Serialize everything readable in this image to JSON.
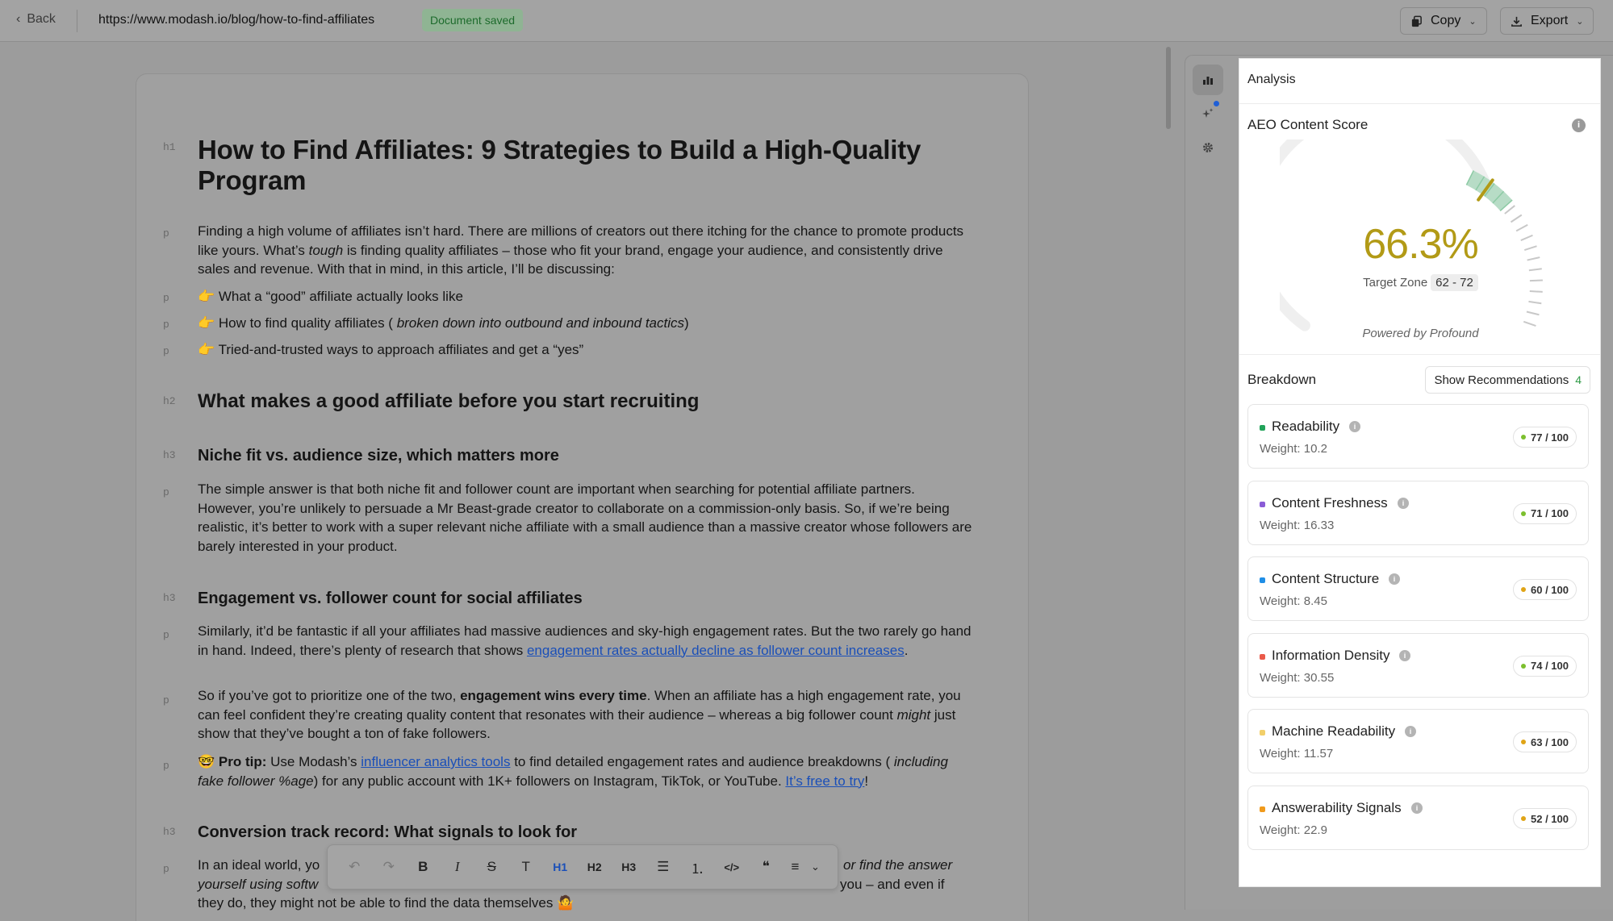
{
  "topbar": {
    "back_label": "Back",
    "url": "https://www.modash.io/blog/how-to-find-affiliates",
    "status": "Document saved",
    "copy_label": "Copy",
    "export_label": "Export"
  },
  "document": {
    "h1": "How to Find Affiliates: 9 Strategies to Build a High-Quality Program",
    "intro": {
      "a": "Finding a high volume of affiliates isn’t hard. There are millions of creators out there itching for the chance to promote products like yours. What’s ",
      "b": "tough",
      "c": " is finding quality affiliates – those who fit your brand, engage your audience, and consistently drive sales and revenue. With that in mind, in this article, I’ll be discussing:"
    },
    "bullets": {
      "one": "👉 What a “good” affiliate actually looks like",
      "two_a": "👉 How to find quality affiliates ( ",
      "two_b": "broken down into outbound and inbound tactics",
      "two_c": ")",
      "three": "👉 Tried-and-trusted ways to approach affiliates and get a “yes”"
    },
    "h2_recruiting": "What makes a good affiliate before you start recruiting",
    "h3_niche": "Niche fit vs. audience size, which matters more",
    "p_niche": "The simple answer is that both niche fit and follower count are important when searching for potential affiliate partners. However, you’re unlikely to persuade a Mr Beast-grade creator to collaborate on a commission-only basis. So, if we’re being realistic, it’s better to work with a super relevant niche affiliate with a small audience than a massive creator whose followers are barely interested in your product.",
    "h3_engagement": "Engagement vs. follower count for social affiliates",
    "p_eng1": {
      "a": "Similarly, it’d be fantastic if all your affiliates had massive audiences and sky-high engagement rates. But the two rarely go hand in hand. Indeed, there’s plenty of research that shows ",
      "link": "engagement rates actually decline as follower count increases",
      "c": "."
    },
    "p_eng2": {
      "a": "So if you’ve got to prioritize one of the two, ",
      "b": "engagement wins every time",
      "c": ". When an affiliate has a high engagement rate, you can feel confident they’re creating quality content that resonates with their audience – whereas a big follower count ",
      "d": "might",
      "e": " just show that they’ve bought a ton of fake followers."
    },
    "p_tip": {
      "emoji": "🤓 ",
      "label": "Pro tip:",
      "a": " Use Modash’s ",
      "link1": "influencer analytics tools",
      "b": " to find detailed engagement rates and audience breakdowns ( ",
      "c": "including fake follower %age",
      "d": ") for any public account with 1K+ followers on Instagram, TikTok, or YouTube. ",
      "link2": "It’s free to try",
      "e": "!"
    },
    "h3_conversion": "Conversion track record: What signals to look for",
    "p_conv": {
      "a": "In an ideal world, yo",
      "b": "or find the answer",
      "c": "yourself using softw",
      "d": " you – and even if",
      "e": "they do, they might not be able to find the data themselves 🤷"
    }
  },
  "tags": {
    "h1": "h1",
    "h2": "h2",
    "h3": "h3",
    "p": "p"
  },
  "toolbar": {
    "undo": "↶",
    "redo": "↷",
    "bold": "B",
    "italic": "I",
    "strike": "S",
    "text": "T",
    "h1": "H1",
    "h2": "H2",
    "h3": "H3",
    "bullets": "☰",
    "numbered": "⒈",
    "code": "</>",
    "quote": "❝",
    "align": "≡",
    "more": "⌄"
  },
  "panel": {
    "header": "Analysis",
    "score_title": "AEO Content Score",
    "score": 66.3,
    "score_text": "66.3%",
    "target_label": "Target Zone",
    "target_zone": "62 - 72",
    "powered_by": "Powered by Profound",
    "breakdown_title": "Breakdown",
    "recommendations_label": "Show Recommendations",
    "recommendations_count": "4",
    "metrics": [
      {
        "name": "Readability",
        "weight": "Weight: 10.2",
        "score": "77 / 100",
        "dot": "#22a35a",
        "score_dot": "#7cbf2e"
      },
      {
        "name": "Content Freshness",
        "weight": "Weight: 16.33",
        "score": "71 / 100",
        "dot": "#8a5cd6",
        "score_dot": "#7cbf2e"
      },
      {
        "name": "Content Structure",
        "weight": "Weight: 8.45",
        "score": "60 / 100",
        "dot": "#1f8ee6",
        "score_dot": "#e0a416"
      },
      {
        "name": "Information Density",
        "weight": "Weight: 30.55",
        "score": "74 / 100",
        "dot": "#ea5a4a",
        "score_dot": "#7cbf2e"
      },
      {
        "name": "Machine Readability",
        "weight": "Weight: 11.57",
        "score": "63 / 100",
        "dot": "#f2cf6a",
        "score_dot": "#e0a416"
      },
      {
        "name": "Answerability Signals",
        "weight": "Weight: 22.9",
        "score": "52 / 100",
        "dot": "#f09a1c",
        "score_dot": "#e0a416"
      }
    ]
  },
  "colors": {
    "score": "#b29a16",
    "link": "#1a4fb8",
    "saved_bg": "#8fb493"
  }
}
